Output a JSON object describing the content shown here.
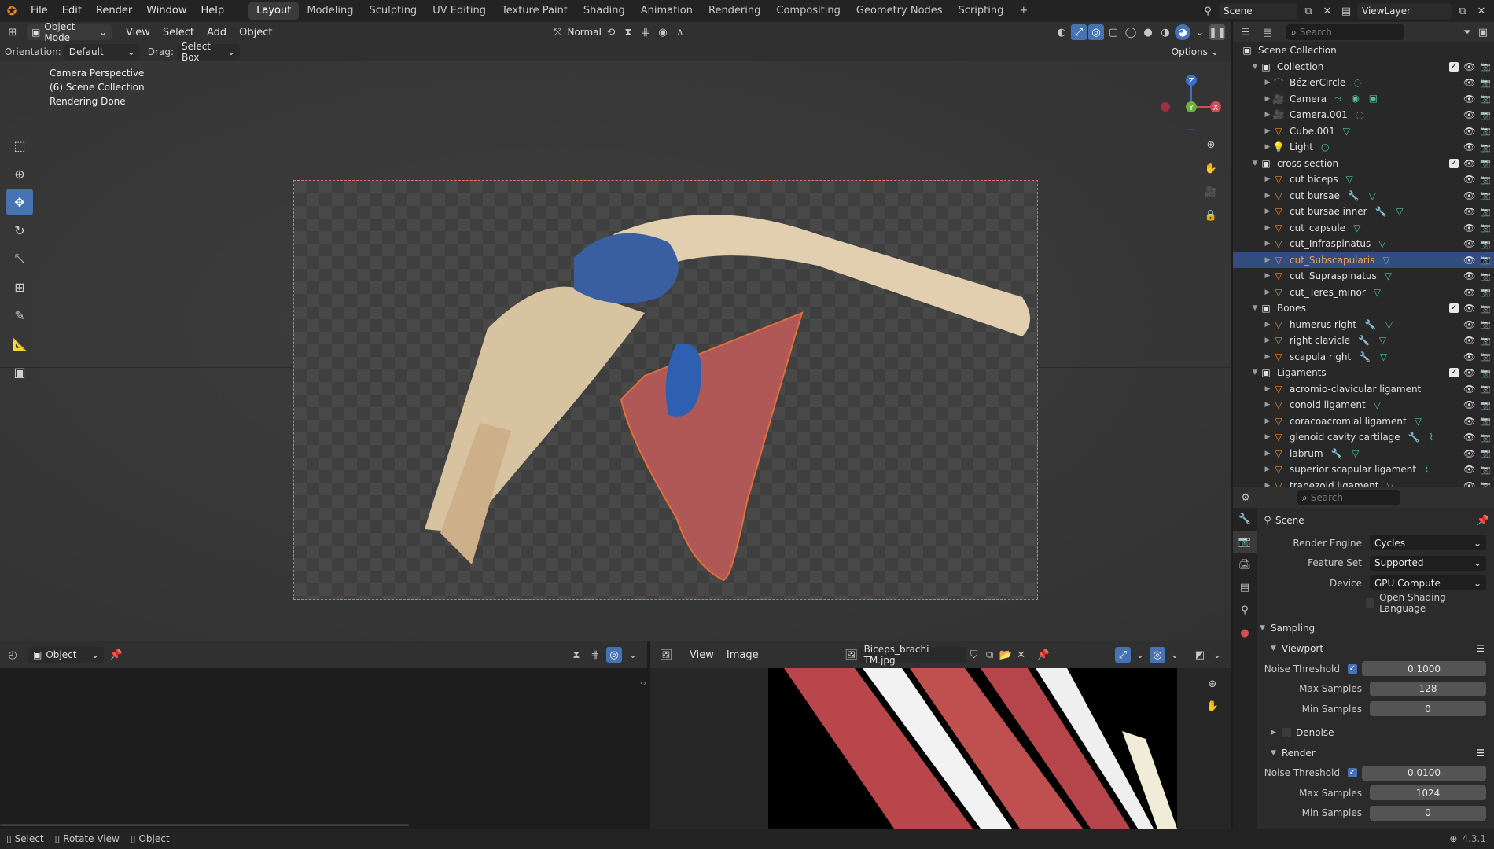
{
  "topbar": {
    "menus": [
      "File",
      "Edit",
      "Render",
      "Window",
      "Help"
    ],
    "workspaces": [
      "Layout",
      "Modeling",
      "Sculpting",
      "UV Editing",
      "Texture Paint",
      "Shading",
      "Animation",
      "Rendering",
      "Compositing",
      "Geometry Nodes",
      "Scripting"
    ],
    "active_workspace": "Layout",
    "add_tab": "+",
    "scene_name": "Scene",
    "view_layer": "ViewLayer"
  },
  "viewport_header": {
    "mode": "Object Mode",
    "menus": [
      "View",
      "Select",
      "Add",
      "Object"
    ],
    "orientation_mode": "Normal"
  },
  "tool_settings": {
    "orientation_label": "Orientation:",
    "orientation_value": "Default",
    "drag_label": "Drag:",
    "drag_value": "Select Box",
    "options": "Options"
  },
  "viewport_overlay": {
    "line1": "Camera Perspective",
    "line2": "(6) Scene Collection",
    "line3": "Rendering Done"
  },
  "gizmo": {
    "z": "Z",
    "y": "Y",
    "x": "X"
  },
  "outliner": {
    "search_placeholder": "Search",
    "root": "Scene Collection",
    "rows": [
      {
        "label": "Collection",
        "level": 1,
        "kind": "collection",
        "mods": ""
      },
      {
        "label": "BézierCircle",
        "level": 2,
        "kind": "curve",
        "mods": "◌"
      },
      {
        "label": "Camera",
        "level": 2,
        "kind": "camera",
        "mods": "⤳ ◉ ▣"
      },
      {
        "label": "Camera.001",
        "level": 2,
        "kind": "camera",
        "mods": "◌"
      },
      {
        "label": "Cube.001",
        "level": 2,
        "kind": "mesh",
        "mods": "▽"
      },
      {
        "label": "Light",
        "level": 2,
        "kind": "light",
        "mods": "○"
      },
      {
        "label": "cross section",
        "level": 1,
        "kind": "collection",
        "mods": ""
      },
      {
        "label": "cut biceps",
        "level": 2,
        "kind": "mesh",
        "mods": "▽"
      },
      {
        "label": "cut bursae",
        "level": 2,
        "kind": "mesh",
        "mods": "🔧 ▽"
      },
      {
        "label": "cut bursae inner",
        "level": 2,
        "kind": "mesh",
        "mods": "🔧 ▽"
      },
      {
        "label": "cut_capsule",
        "level": 2,
        "kind": "mesh",
        "mods": "▽"
      },
      {
        "label": "cut_Infraspinatus",
        "level": 2,
        "kind": "mesh",
        "mods": "▽"
      },
      {
        "label": "cut_Subscapularis",
        "level": 2,
        "kind": "mesh",
        "mods": "▽",
        "selected": true
      },
      {
        "label": "cut_Supraspinatus",
        "level": 2,
        "kind": "mesh",
        "mods": "▽"
      },
      {
        "label": "cut_Teres_minor",
        "level": 2,
        "kind": "mesh",
        "mods": "▽"
      },
      {
        "label": "Bones",
        "level": 1,
        "kind": "collection",
        "mods": ""
      },
      {
        "label": "humerus right",
        "level": 2,
        "kind": "mesh",
        "mods": "🔧 ▽"
      },
      {
        "label": "right clavicle",
        "level": 2,
        "kind": "mesh",
        "mods": "🔧 ▽"
      },
      {
        "label": "scapula right",
        "level": 2,
        "kind": "mesh",
        "mods": "🔧 ▽"
      },
      {
        "label": "Ligaments",
        "level": 1,
        "kind": "collection",
        "mods": ""
      },
      {
        "label": "acromio-clavicular ligament",
        "level": 2,
        "kind": "mesh",
        "mods": ""
      },
      {
        "label": "conoid ligament",
        "level": 2,
        "kind": "mesh",
        "mods": "▽"
      },
      {
        "label": "coracoacromial ligament",
        "level": 2,
        "kind": "mesh",
        "mods": "▽"
      },
      {
        "label": "glenoid cavity cartilage",
        "level": 2,
        "kind": "mesh",
        "mods": "🔧 ⌇"
      },
      {
        "label": "labrum",
        "level": 2,
        "kind": "mesh",
        "mods": "🔧 ▽"
      },
      {
        "label": "superior scapular ligament",
        "level": 2,
        "kind": "mesh",
        "mods": "⌇"
      },
      {
        "label": "trapezoid ligament",
        "level": 2,
        "kind": "mesh",
        "mods": "▽"
      }
    ]
  },
  "properties": {
    "search_placeholder": "Search",
    "context": "Scene",
    "render_engine_label": "Render Engine",
    "render_engine": "Cycles",
    "feature_set_label": "Feature Set",
    "feature_set": "Supported",
    "device_label": "Device",
    "device": "GPU Compute",
    "osl_label": "Open Shading Language",
    "sampling": "Sampling",
    "viewport": "Viewport",
    "vp_noise_label": "Noise Threshold",
    "vp_noise": "0.1000",
    "vp_max_label": "Max Samples",
    "vp_max": "128",
    "vp_min_label": "Min Samples",
    "vp_min": "0",
    "denoise": "Denoise",
    "render": "Render",
    "r_noise_label": "Noise Threshold",
    "r_noise": "0.0100",
    "r_max_label": "Max Samples",
    "r_max": "1024",
    "r_min_label": "Min Samples",
    "r_min": "0"
  },
  "timeline": {
    "mode": "Object"
  },
  "image_editor": {
    "menus": [
      "View",
      "Image"
    ],
    "image_name": "Biceps_brachi TM.jpg"
  },
  "statusbar": {
    "select": "Select",
    "rotate": "Rotate View",
    "object": "Object",
    "version": "4.3.1"
  },
  "colors": {
    "accent": "#4772b3",
    "selected_row": "#334d80",
    "selected_text": "#f0a050",
    "modifier_green": "#4bc0a0"
  }
}
